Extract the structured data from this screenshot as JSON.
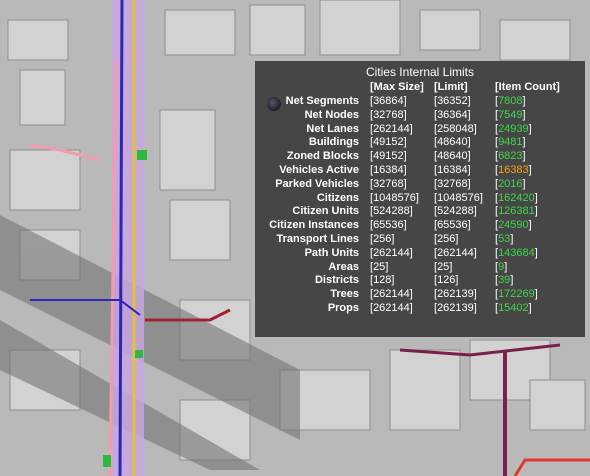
{
  "panel": {
    "title": "Cities Internal Limits",
    "headers": {
      "max_size": "[Max Size]",
      "limit": "[Limit]",
      "item_count": "[Item Count]"
    },
    "rows": [
      {
        "name": "Net Segments",
        "max_size": "36864",
        "limit": "36352",
        "count": "7808",
        "status": "ok"
      },
      {
        "name": "Net Nodes",
        "max_size": "32768",
        "limit": "36364",
        "count": "7549",
        "status": "ok"
      },
      {
        "name": "Net Lanes",
        "max_size": "262144",
        "limit": "258048",
        "count": "24939",
        "status": "ok"
      },
      {
        "name": "Buildings",
        "max_size": "49152",
        "limit": "48640",
        "count": "9481",
        "status": "ok"
      },
      {
        "name": "Zoned Blocks",
        "max_size": "49152",
        "limit": "48640",
        "count": "6823",
        "status": "ok"
      },
      {
        "name": "Vehicles Active",
        "max_size": "16384",
        "limit": "16384",
        "count": "16383",
        "status": "warn"
      },
      {
        "name": "Parked Vehicles",
        "max_size": "32768",
        "limit": "32768",
        "count": "2016",
        "status": "ok"
      },
      {
        "name": "Citizens",
        "max_size": "1048576",
        "limit": "1048576",
        "count": "162420",
        "status": "ok"
      },
      {
        "name": "Citizen Units",
        "max_size": "524288",
        "limit": "524288",
        "count": "126381",
        "status": "ok"
      },
      {
        "name": "Citizen Instances",
        "max_size": "65536",
        "limit": "65536",
        "count": "24590",
        "status": "ok"
      },
      {
        "name": "Transport Lines",
        "max_size": "256",
        "limit": "256",
        "count": "53",
        "status": "ok"
      },
      {
        "name": "Path Units",
        "max_size": "262144",
        "limit": "262144",
        "count": "143684",
        "status": "ok"
      },
      {
        "name": "Areas",
        "max_size": "25",
        "limit": "25",
        "count": "9",
        "status": "ok"
      },
      {
        "name": "Districts",
        "max_size": "128",
        "limit": "126",
        "count": "39",
        "status": "ok"
      },
      {
        "name": "Trees",
        "max_size": "262144",
        "limit": "262139",
        "count": "172269",
        "status": "ok"
      },
      {
        "name": "Props",
        "max_size": "262144",
        "limit": "262139",
        "count": "15402",
        "status": "ok"
      }
    ]
  },
  "colors": {
    "ok": "#3fd64a",
    "warn": "#f2a51c",
    "panel_bg": "#2d2d2d"
  }
}
